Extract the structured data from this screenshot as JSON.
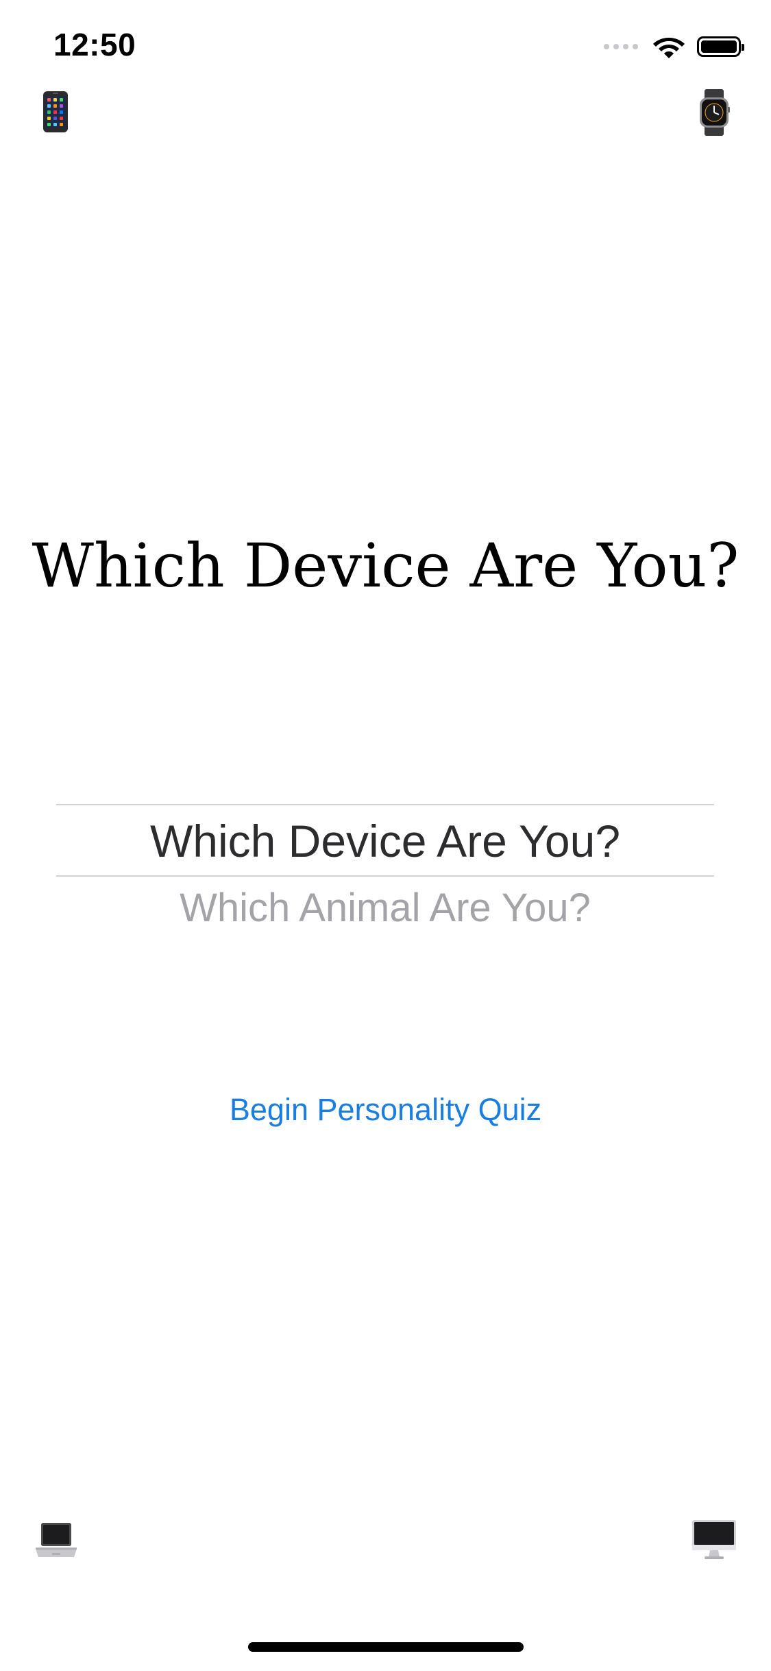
{
  "status_bar": {
    "time": "12:50"
  },
  "quiz": {
    "title": "Which Device Are You?"
  },
  "picker": {
    "selected": "Which Device Are You?",
    "next": "Which Animal Are You?"
  },
  "actions": {
    "begin_label": "Begin Personality Quiz"
  },
  "colors": {
    "accent": "#1a7ee0",
    "picker_selected": "#2c2c2e",
    "picker_dim": "#a3a3a8",
    "separator": "#d1d1d6"
  },
  "icons": {
    "top_left": "iphone-icon",
    "top_right": "apple-watch-icon",
    "bottom_left": "laptop-icon",
    "bottom_right": "desktop-computer-icon"
  }
}
